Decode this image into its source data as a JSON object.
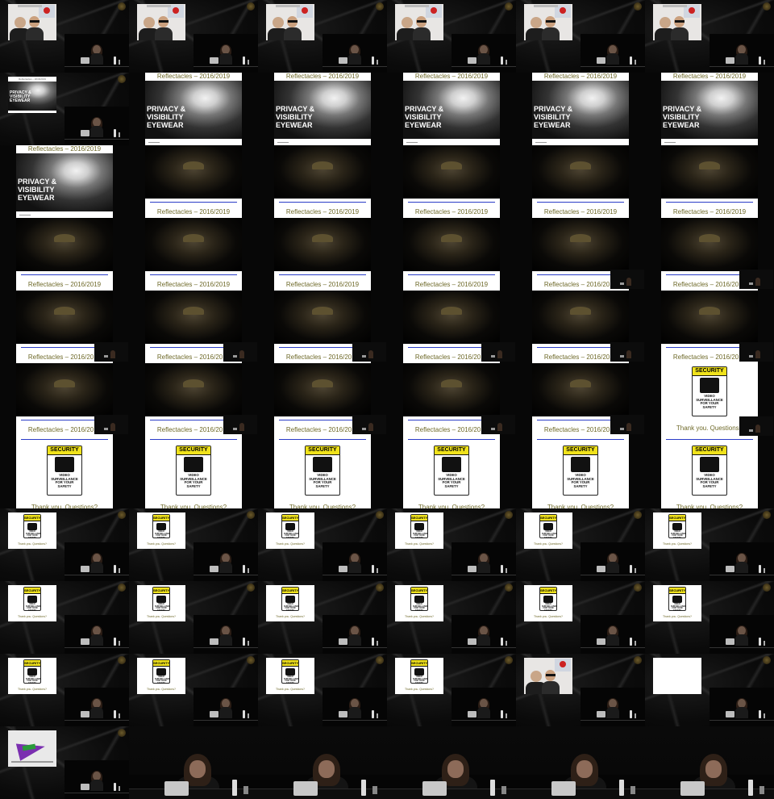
{
  "sheet": {
    "columns": 6,
    "rows": 11
  },
  "slides": {
    "reflectacles_title": "Reflectacles – 2016/2019",
    "privacy_title": "PRIVACY & VISIBILITY EYEWEAR",
    "security_header": "SECURITY",
    "security_body": "VIDEO SURVEILLANCE FOR YOUR SAFETY",
    "thanks_text": "Thank you. Questions?"
  },
  "frames": [
    "guests",
    "guests",
    "guests",
    "guests",
    "guests",
    "guests",
    "privacy-small",
    "privacy",
    "privacy",
    "privacy",
    "privacy",
    "privacy",
    "privacy-title-top",
    "glasses",
    "glasses",
    "glasses",
    "glasses",
    "glasses",
    "glasses",
    "glasses",
    "glasses",
    "glasses",
    "glasses-inset",
    "glasses-inset",
    "glasses-inset",
    "glasses-inset",
    "glasses-inset",
    "glasses-inset",
    "glasses-inset",
    "glasses-inset",
    "glasses-inset",
    "glasses-inset",
    "glasses-inset",
    "glasses-inset",
    "glasses-inset",
    "security-inset",
    "security",
    "security",
    "security",
    "security",
    "security",
    "security",
    "security-small",
    "security-small",
    "security-small",
    "security-small",
    "security-small",
    "security-small",
    "security-small",
    "security-small",
    "security-small",
    "security-small",
    "security-small",
    "security-small",
    "security-small",
    "security-small",
    "security-small",
    "security-small",
    "guests-small",
    "thumbs-small",
    "wing-small",
    "closeup",
    "closeup",
    "closeup",
    "closeup",
    "closeup"
  ],
  "colors": {
    "background": "#000000",
    "slide_title": "#6f6a2a",
    "sign_yellow": "#f0e21b",
    "link_blue": "#2a3cc7"
  }
}
